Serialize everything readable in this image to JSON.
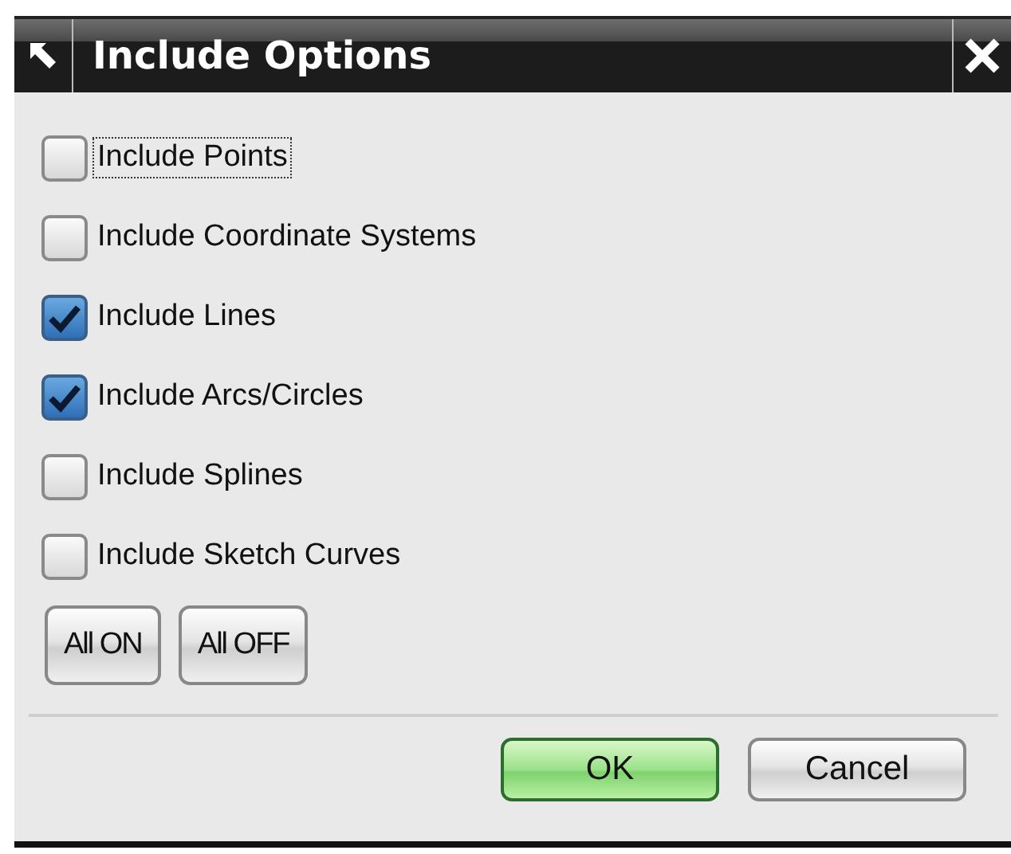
{
  "window": {
    "title": "Include Options"
  },
  "options": [
    {
      "label": "Include Points",
      "checked": false,
      "focused": true
    },
    {
      "label": "Include Coordinate Systems",
      "checked": false,
      "focused": false
    },
    {
      "label": "Include Lines",
      "checked": true,
      "focused": false
    },
    {
      "label": "Include Arcs/Circles",
      "checked": true,
      "focused": false
    },
    {
      "label": "Include Splines",
      "checked": false,
      "focused": false
    },
    {
      "label": "Include Sketch Curves",
      "checked": false,
      "focused": false
    }
  ],
  "toggle_buttons": [
    "All ON",
    "All OFF"
  ],
  "buttons": [
    {
      "label": "OK",
      "kind": "default"
    },
    {
      "label": "Cancel",
      "kind": "normal"
    }
  ]
}
